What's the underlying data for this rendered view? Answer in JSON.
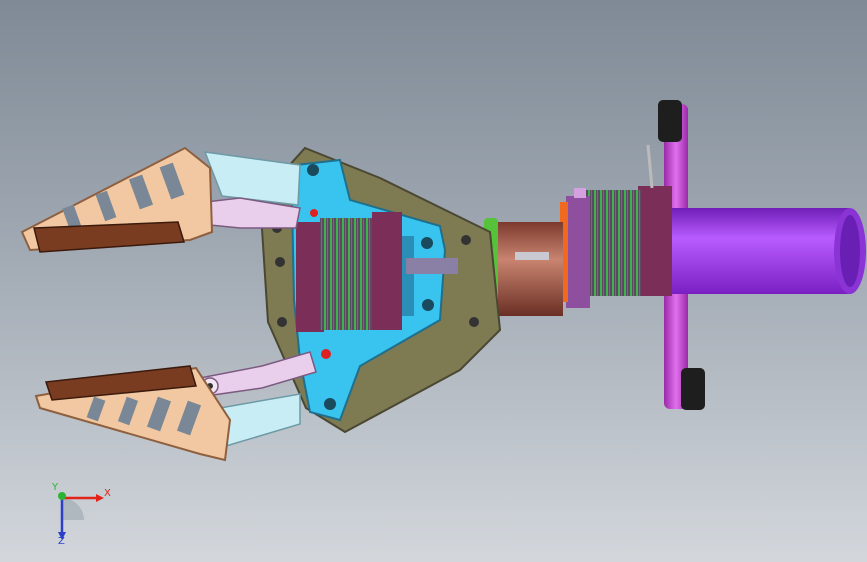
{
  "viewport": {
    "background_top": "#7f8a96",
    "background_bottom": "#d3d7dc"
  },
  "model": {
    "colors": {
      "finger_plate": "#f2c8a2",
      "finger_pad": "#7a3c20",
      "linkage": "#c9edf5",
      "link_arm": "#e9cfeb",
      "base_plate": "#7e7a52",
      "motor_bracket": "#38c4ee",
      "motor_body": "#7b2f58",
      "motor_windings": "#4e6a5c",
      "coupler": "#b06a58",
      "ring_green": "#55c23a",
      "ring_orange": "#ef6a1e",
      "cylinder": "#a347f2",
      "crossbar": "#cc4fd8",
      "grip": "#222222"
    }
  },
  "triad": {
    "x_label": "X",
    "y_label": "Y",
    "z_label": "Z",
    "x_color": "#e2231a",
    "y_color": "#2bb432",
    "z_color": "#2c3fc9"
  }
}
